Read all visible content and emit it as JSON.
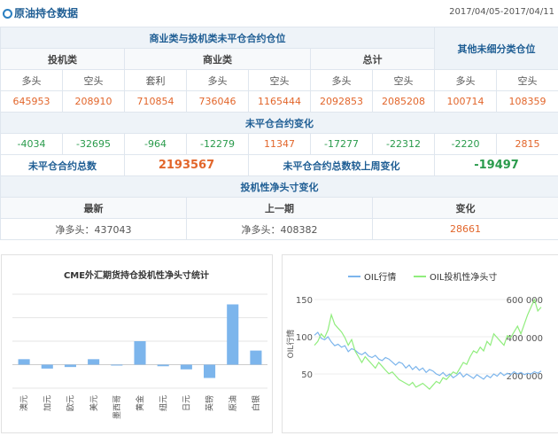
{
  "header": {
    "title": "原油持仓数据",
    "date_range": "2017/04/05-2017/04/11"
  },
  "table": {
    "group_title": "商业类与投机类未平仓合约仓位",
    "other_title": "其他未细分类仓位",
    "groups": [
      "投机类",
      "商业类",
      "总计"
    ],
    "sub": [
      "多头",
      "空头",
      "套利",
      "多头",
      "空头",
      "多头",
      "空头",
      "多头",
      "空头"
    ],
    "values": [
      "645953",
      "208910",
      "710854",
      "736046",
      "1165444",
      "2092853",
      "2085208",
      "100714",
      "108359"
    ],
    "change_title": "未平仓合约变化",
    "changes": [
      "-4034",
      "-32695",
      "-964",
      "-12279",
      "11347",
      "-17277",
      "-22312",
      "-2220",
      "2815"
    ],
    "total_label": "未平仓合约总数",
    "total_value": "2193567",
    "weekly_label": "未平仓合约总数较上周变化",
    "weekly_value": "-19497",
    "spec_title": "投机性净头寸变化",
    "spec_headers": [
      "最新",
      "上一期",
      "变化"
    ],
    "spec_values": [
      "净多头：437043",
      "净多头：408382",
      "28661"
    ]
  },
  "chart_data": [
    {
      "type": "bar",
      "title": "CME外汇期货持仓投机性净头寸统计",
      "categories": [
        "澳元",
        "加元",
        "欧元",
        "美元",
        "墨西哥",
        "黄金",
        "纽元",
        "日元",
        "英镑",
        "原油",
        "白银"
      ],
      "values": [
        0.7,
        -0.5,
        -0.3,
        0.7,
        -0.1,
        3.0,
        -0.2,
        -0.6,
        -1.7,
        7.7,
        1.8
      ],
      "ylim": [
        -3,
        9
      ],
      "grid": true,
      "colors": {
        "bar": "#7cb5ec"
      }
    },
    {
      "type": "line",
      "series": [
        {
          "name": "OIL行情",
          "axis": "left",
          "color": "#7cb5ec",
          "values": [
            102,
            106,
            98,
            96,
            100,
            93,
            88,
            90,
            86,
            88,
            80,
            84,
            82,
            78,
            76,
            79,
            74,
            72,
            75,
            70,
            68,
            72,
            70,
            66,
            62,
            66,
            64,
            58,
            62,
            56,
            60,
            55,
            58,
            52,
            56,
            54,
            50,
            48,
            52,
            47,
            50,
            45,
            48,
            52,
            46,
            50,
            47,
            44,
            49,
            46,
            43,
            48,
            45,
            50,
            47,
            52,
            48,
            51,
            49,
            53,
            50,
            52,
            49,
            51,
            50,
            53,
            51,
            54
          ]
        },
        {
          "name": "OIL投机性净头寸",
          "axis": "right",
          "color": "#90ed7d",
          "values": [
            360,
            380,
            420,
            400,
            440,
            520,
            470,
            450,
            430,
            400,
            360,
            390,
            330,
            300,
            270,
            300,
            280,
            260,
            240,
            270,
            250,
            230,
            210,
            220,
            200,
            180,
            170,
            160,
            150,
            165,
            140,
            150,
            160,
            145,
            130,
            150,
            170,
            160,
            190,
            180,
            200,
            220,
            210,
            240,
            270,
            260,
            300,
            330,
            320,
            350,
            330,
            380,
            360,
            420,
            400,
            380,
            360,
            410,
            400,
            430,
            460,
            420,
            470,
            520,
            560,
            600,
            540,
            560
          ]
        }
      ],
      "ylabel": "OIL行情",
      "yticks_left": [
        50,
        100,
        150
      ],
      "yticks_right": [
        200000,
        400000,
        600000
      ],
      "yticks_right_labels": [
        "200 000",
        "400 000",
        "600 000"
      ],
      "legend": "top"
    }
  ]
}
